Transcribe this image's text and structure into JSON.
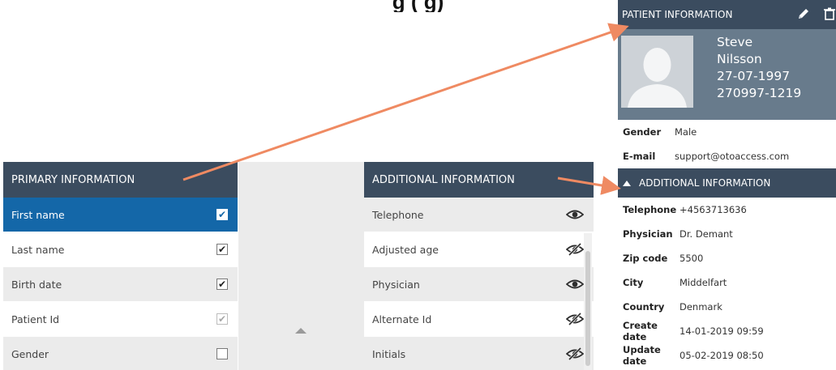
{
  "title_clipped": "g   (                 g)",
  "primary": {
    "header": "PRIMARY INFORMATION",
    "rows": [
      {
        "label": "First name",
        "checked": true,
        "state": "selected"
      },
      {
        "label": "Last name",
        "checked": true,
        "state": "normal"
      },
      {
        "label": "Birth date",
        "checked": true,
        "state": "normal"
      },
      {
        "label": "Patient Id",
        "checked": true,
        "state": "disabled"
      },
      {
        "label": "Gender",
        "checked": false,
        "state": "normal"
      }
    ]
  },
  "additional": {
    "header": "ADDITIONAL INFORMATION",
    "rows": [
      {
        "label": "Telephone",
        "icon": "eye-icon"
      },
      {
        "label": "Adjusted age",
        "icon": "eye-slash-icon"
      },
      {
        "label": "Physician",
        "icon": "eye-icon"
      },
      {
        "label": "Alternate Id",
        "icon": "eye-slash-icon"
      },
      {
        "label": "Initials",
        "icon": "eye-slash-icon"
      }
    ]
  },
  "patient": {
    "header": "PATIENT INFORMATION",
    "first_name": "Steve",
    "last_name": "Nilsson",
    "birth_date": "27-07-1997",
    "patient_id": "270997-1219",
    "fields": [
      {
        "key": "Gender",
        "value": "Male"
      },
      {
        "key": "E-mail",
        "value": "support@otoaccess.com"
      }
    ],
    "additional_header": "ADDITIONAL INFORMATION",
    "additional_fields": [
      {
        "key": "Telephone",
        "value": "+4563713636"
      },
      {
        "key": "Physician",
        "value": "Dr. Demant"
      },
      {
        "key": "Zip code",
        "value": "5500"
      },
      {
        "key": "City",
        "value": "Middelfart"
      },
      {
        "key": "Country",
        "value": "Denmark"
      },
      {
        "key": "Create date",
        "value": "14-01-2019 09:59"
      },
      {
        "key": "Update date",
        "value": "05-02-2019 08:50"
      }
    ]
  },
  "colors": {
    "header_bg": "#3b4c5f",
    "selected_row": "#1467a8",
    "arrow": "#ef8a62",
    "profile_bg": "#687b8c"
  }
}
